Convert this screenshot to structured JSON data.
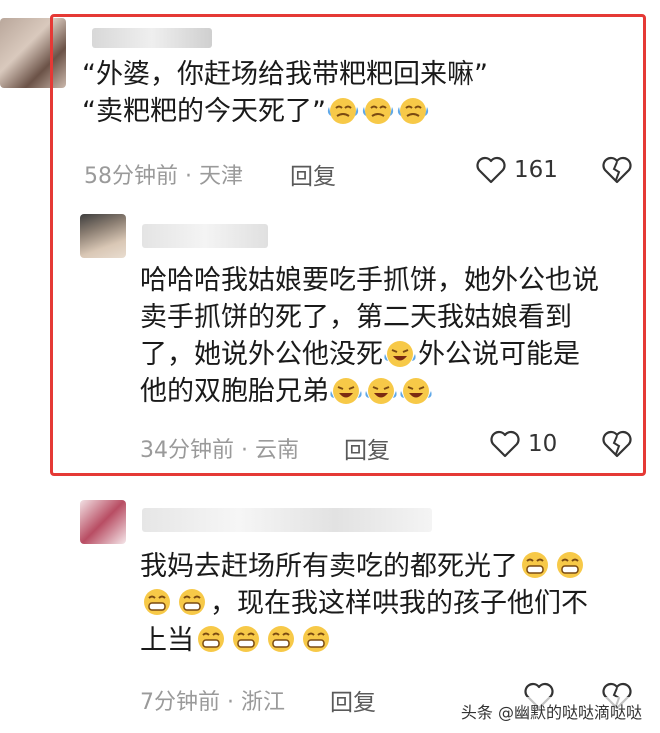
{
  "comments": [
    {
      "lines": [
        "“外婆，你赶场给我带粑粑回来嘛”",
        "“卖粑粑的今天死了”"
      ],
      "time_location": "58分钟前 · 天津",
      "reply_label": "回复",
      "likes": "161"
    },
    {
      "lines": [
        "哈哈哈我姑娘要吃手抓饼，她外公也说",
        "卖手抓饼的死了，第二天我姑娘看到",
        "了，她说外公他没死",
        "外公说可能是",
        "他的双胞胎兄弟"
      ],
      "time_location": "34分钟前 · 云南",
      "reply_label": "回复",
      "likes": "10"
    },
    {
      "lines": [
        "我妈去赶场所有卖吃的都死光了",
        "，现在我这样哄我的孩子他们不",
        "上当"
      ],
      "time_location": "7分钟前 · 浙江",
      "reply_label": "回复"
    }
  ],
  "watermark": "头条 @幽默的哒哒滴哒哒",
  "icons": {
    "like": "heart-icon",
    "dislike": "broken-heart-icon",
    "emoji_cry_laugh": "laughing-crying-emoji",
    "emoji_grin": "grinning-emoji",
    "emoji_tears": "tearful-emoji"
  },
  "colors": {
    "highlight_border": "#e53935",
    "meta_text": "#9a9a9a"
  }
}
